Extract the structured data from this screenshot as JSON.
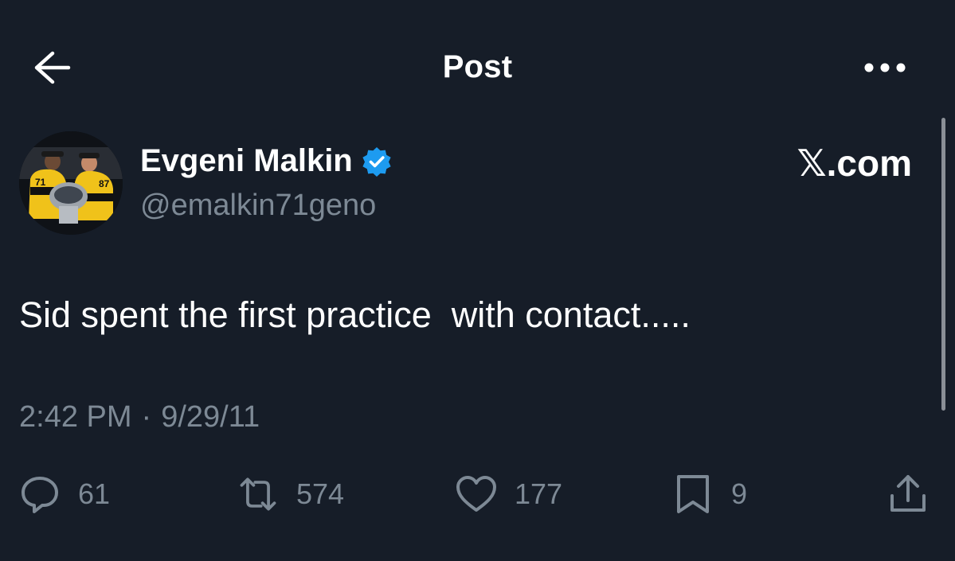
{
  "header": {
    "title": "Post",
    "back_icon": "arrow-left-icon",
    "more_icon": "more-horizontal-icon"
  },
  "post": {
    "author_name": "Evgeni Malkin",
    "author_handle": "@emalkin71geno",
    "verified": true,
    "brand": "𝕏.com",
    "text": "Sid spent the first practice  with contact.....",
    "time": "2:42 PM",
    "separator": "·",
    "date": "9/29/11"
  },
  "actions": {
    "replies": "61",
    "reposts": "574",
    "likes": "177",
    "bookmarks": "9"
  },
  "colors": {
    "background": "#161d28",
    "text": "#ffffff",
    "secondary": "#7d8995",
    "verified": "#1d9bf0"
  }
}
